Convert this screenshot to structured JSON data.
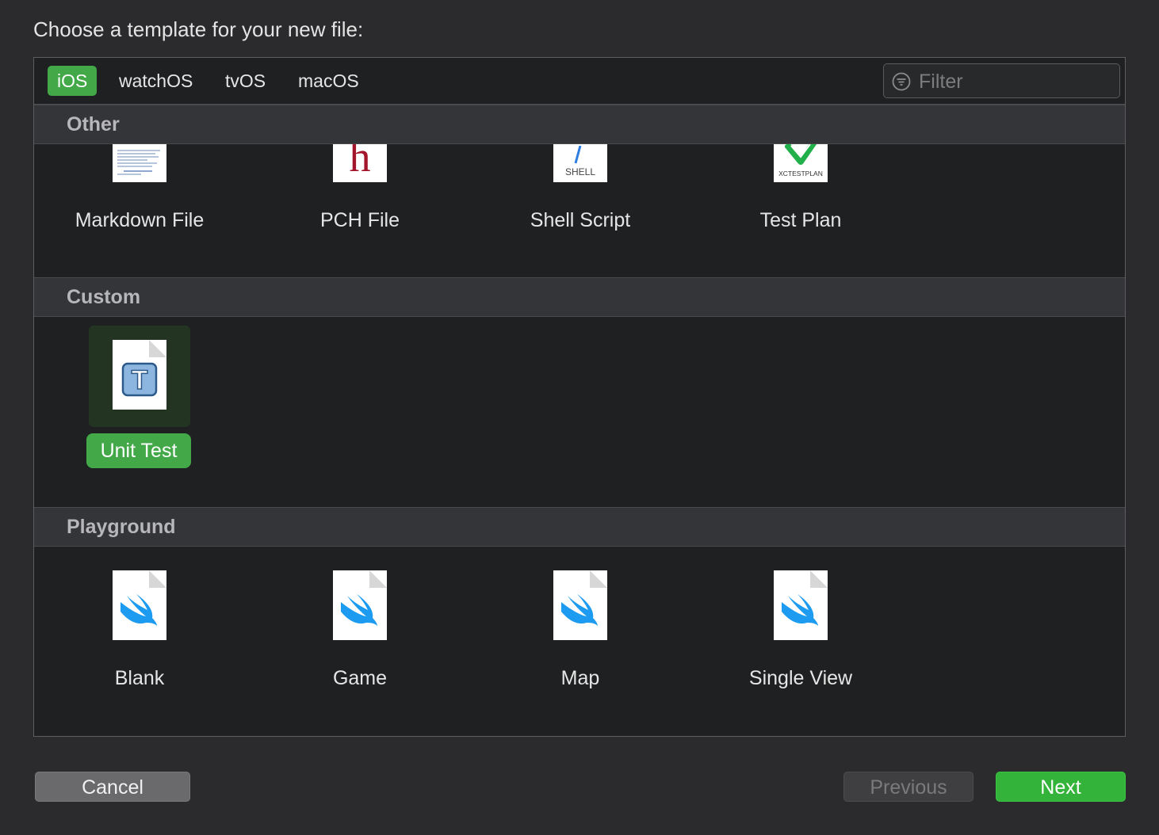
{
  "prompt": "Choose a template for your new file:",
  "platform_tabs": [
    {
      "label": "iOS",
      "active": true
    },
    {
      "label": "watchOS",
      "active": false
    },
    {
      "label": "tvOS",
      "active": false
    },
    {
      "label": "macOS",
      "active": false
    }
  ],
  "filter": {
    "placeholder": "Filter",
    "value": ""
  },
  "sections": {
    "other": {
      "title": "Other",
      "items": [
        {
          "label": "Markdown File",
          "icon": "markdown-file-icon"
        },
        {
          "label": "PCH File",
          "icon": "pch-file-icon",
          "glyph": "h"
        },
        {
          "label": "Shell Script",
          "icon": "shell-script-icon",
          "glyph": "SHELL"
        },
        {
          "label": "Test Plan",
          "icon": "test-plan-icon",
          "glyph": "XCTESTPLAN"
        }
      ]
    },
    "custom": {
      "title": "Custom",
      "items": [
        {
          "label": "Unit Test",
          "icon": "unit-test-icon",
          "glyph": "T",
          "selected": true
        }
      ]
    },
    "playground": {
      "title": "Playground",
      "items": [
        {
          "label": "Blank",
          "icon": "swift-icon"
        },
        {
          "label": "Game",
          "icon": "swift-icon"
        },
        {
          "label": "Map",
          "icon": "swift-icon"
        },
        {
          "label": "Single View",
          "icon": "swift-icon"
        }
      ]
    }
  },
  "buttons": {
    "cancel": "Cancel",
    "previous": "Previous",
    "next": "Next"
  },
  "colors": {
    "accent": "#43a948",
    "next_button": "#34b33a",
    "background": "#1f2022"
  }
}
